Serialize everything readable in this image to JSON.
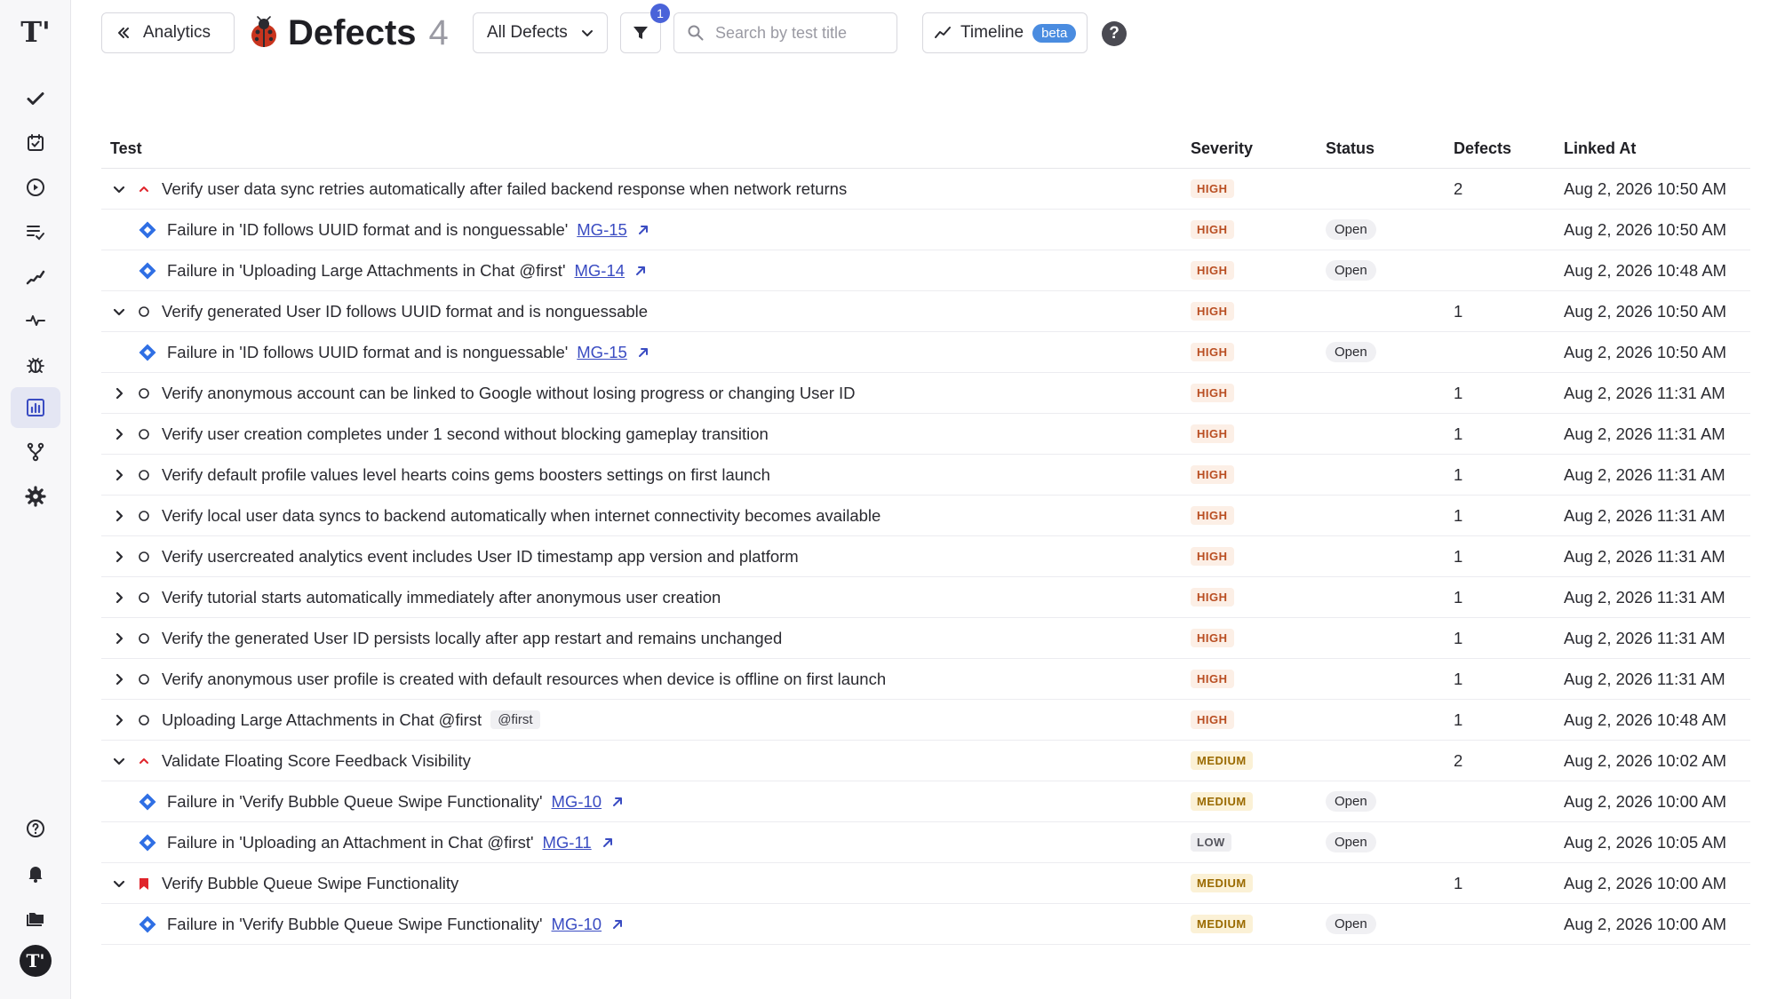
{
  "header": {
    "back_label": "Analytics",
    "title": "Defects",
    "count": "4",
    "filter_select": "All Defects",
    "filter_badge": "1",
    "search_placeholder": "Search by test title",
    "timeline_label": "Timeline",
    "beta_label": "beta",
    "help_label": "?"
  },
  "colors": {
    "accent": "#4a63d9",
    "link": "#3a4cc2",
    "severity_high": "#b94e22",
    "severity_medium": "#9a6a00",
    "jira_blue": "#2f6fe4",
    "flag_red": "#e0242b"
  },
  "sidebar": {
    "logo": "T'",
    "items": [
      {
        "icon": "check-icon"
      },
      {
        "icon": "clipboard-check-icon"
      },
      {
        "icon": "play-icon"
      },
      {
        "icon": "list-check-icon"
      },
      {
        "icon": "stairs-icon"
      },
      {
        "icon": "pulse-icon"
      },
      {
        "icon": "bug-icon"
      },
      {
        "icon": "analytics-icon",
        "active": true
      },
      {
        "icon": "fork-icon"
      },
      {
        "icon": "gear-icon"
      }
    ],
    "bottom": [
      {
        "icon": "help-icon"
      },
      {
        "icon": "bell-icon"
      },
      {
        "icon": "folders-icon"
      }
    ],
    "avatar": "T'"
  },
  "table": {
    "columns": [
      "Test",
      "Severity",
      "Status",
      "Defects",
      "Linked At"
    ],
    "rows": [
      {
        "kind": "parent",
        "expanded": true,
        "state": "high-arrow",
        "test": "Verify user data sync retries automatically after failed backend response when network returns",
        "severity": "HIGH",
        "status": "",
        "defects": "2",
        "linked_at": "Aug 2, 2026 10:50 AM"
      },
      {
        "kind": "child",
        "test": "Failure in 'ID follows UUID format and is nonguessable'",
        "issue": "MG-15",
        "severity": "HIGH",
        "status": "Open",
        "defects": "",
        "linked_at": "Aug 2, 2026 10:50 AM"
      },
      {
        "kind": "child",
        "test": "Failure in 'Uploading Large Attachments in Chat @first'",
        "issue": "MG-14",
        "severity": "HIGH",
        "status": "Open",
        "defects": "",
        "linked_at": "Aug 2, 2026 10:48 AM"
      },
      {
        "kind": "parent",
        "expanded": true,
        "state": "circle",
        "test": "Verify generated User ID follows UUID format and is nonguessable",
        "severity": "HIGH",
        "status": "",
        "defects": "1",
        "linked_at": "Aug 2, 2026 10:50 AM"
      },
      {
        "kind": "child",
        "test": "Failure in 'ID follows UUID format and is nonguessable'",
        "issue": "MG-15",
        "severity": "HIGH",
        "status": "Open",
        "defects": "",
        "linked_at": "Aug 2, 2026 10:50 AM"
      },
      {
        "kind": "parent",
        "expanded": false,
        "state": "circle",
        "test": "Verify anonymous account can be linked to Google without losing progress or changing User ID",
        "severity": "HIGH",
        "status": "",
        "defects": "1",
        "linked_at": "Aug 2, 2026 11:31 AM"
      },
      {
        "kind": "parent",
        "expanded": false,
        "state": "circle",
        "test": "Verify user creation completes under 1 second without blocking gameplay transition",
        "severity": "HIGH",
        "status": "",
        "defects": "1",
        "linked_at": "Aug 2, 2026 11:31 AM"
      },
      {
        "kind": "parent",
        "expanded": false,
        "state": "circle",
        "test": "Verify default profile values level hearts coins gems boosters settings on first launch",
        "severity": "HIGH",
        "status": "",
        "defects": "1",
        "linked_at": "Aug 2, 2026 11:31 AM"
      },
      {
        "kind": "parent",
        "expanded": false,
        "state": "circle",
        "test": "Verify local user data syncs to backend automatically when internet connectivity becomes available",
        "severity": "HIGH",
        "status": "",
        "defects": "1",
        "linked_at": "Aug 2, 2026 11:31 AM"
      },
      {
        "kind": "parent",
        "expanded": false,
        "state": "circle",
        "test": "Verify usercreated analytics event includes User ID timestamp app version and platform",
        "severity": "HIGH",
        "status": "",
        "defects": "1",
        "linked_at": "Aug 2, 2026 11:31 AM"
      },
      {
        "kind": "parent",
        "expanded": false,
        "state": "circle",
        "test": "Verify tutorial starts automatically immediately after anonymous user creation",
        "severity": "HIGH",
        "status": "",
        "defects": "1",
        "linked_at": "Aug 2, 2026 11:31 AM"
      },
      {
        "kind": "parent",
        "expanded": false,
        "state": "circle",
        "test": "Verify the generated User ID persists locally after app restart and remains unchanged",
        "severity": "HIGH",
        "status": "",
        "defects": "1",
        "linked_at": "Aug 2, 2026 11:31 AM"
      },
      {
        "kind": "parent",
        "expanded": false,
        "state": "circle",
        "test": "Verify anonymous user profile is created with default resources when device is offline on first launch",
        "severity": "HIGH",
        "status": "",
        "defects": "1",
        "linked_at": "Aug 2, 2026 11:31 AM"
      },
      {
        "kind": "parent",
        "expanded": false,
        "state": "circle",
        "test": "Uploading Large Attachments in Chat @first",
        "tag": "@first",
        "severity": "HIGH",
        "status": "",
        "defects": "1",
        "linked_at": "Aug 2, 2026 10:48 AM"
      },
      {
        "kind": "parent",
        "expanded": true,
        "state": "high-arrow",
        "test": "Validate Floating Score Feedback Visibility",
        "severity": "MEDIUM",
        "status": "",
        "defects": "2",
        "linked_at": "Aug 2, 2026 10:02 AM"
      },
      {
        "kind": "child",
        "test": "Failure in 'Verify Bubble Queue Swipe Functionality'",
        "issue": "MG-10",
        "severity": "MEDIUM",
        "status": "Open",
        "defects": "",
        "linked_at": "Aug 2, 2026 10:00 AM"
      },
      {
        "kind": "child",
        "test": "Failure in 'Uploading an Attachment in Chat @first'",
        "issue": "MG-11",
        "severity": "LOW",
        "status": "Open",
        "defects": "",
        "linked_at": "Aug 2, 2026 10:05 AM"
      },
      {
        "kind": "parent",
        "expanded": true,
        "state": "flag",
        "test": "Verify Bubble Queue Swipe Functionality",
        "severity": "MEDIUM",
        "status": "",
        "defects": "1",
        "linked_at": "Aug 2, 2026 10:00 AM"
      },
      {
        "kind": "child",
        "test": "Failure in 'Verify Bubble Queue Swipe Functionality'",
        "issue": "MG-10",
        "severity": "MEDIUM",
        "status": "Open",
        "defects": "",
        "linked_at": "Aug 2, 2026 10:00 AM"
      }
    ]
  }
}
